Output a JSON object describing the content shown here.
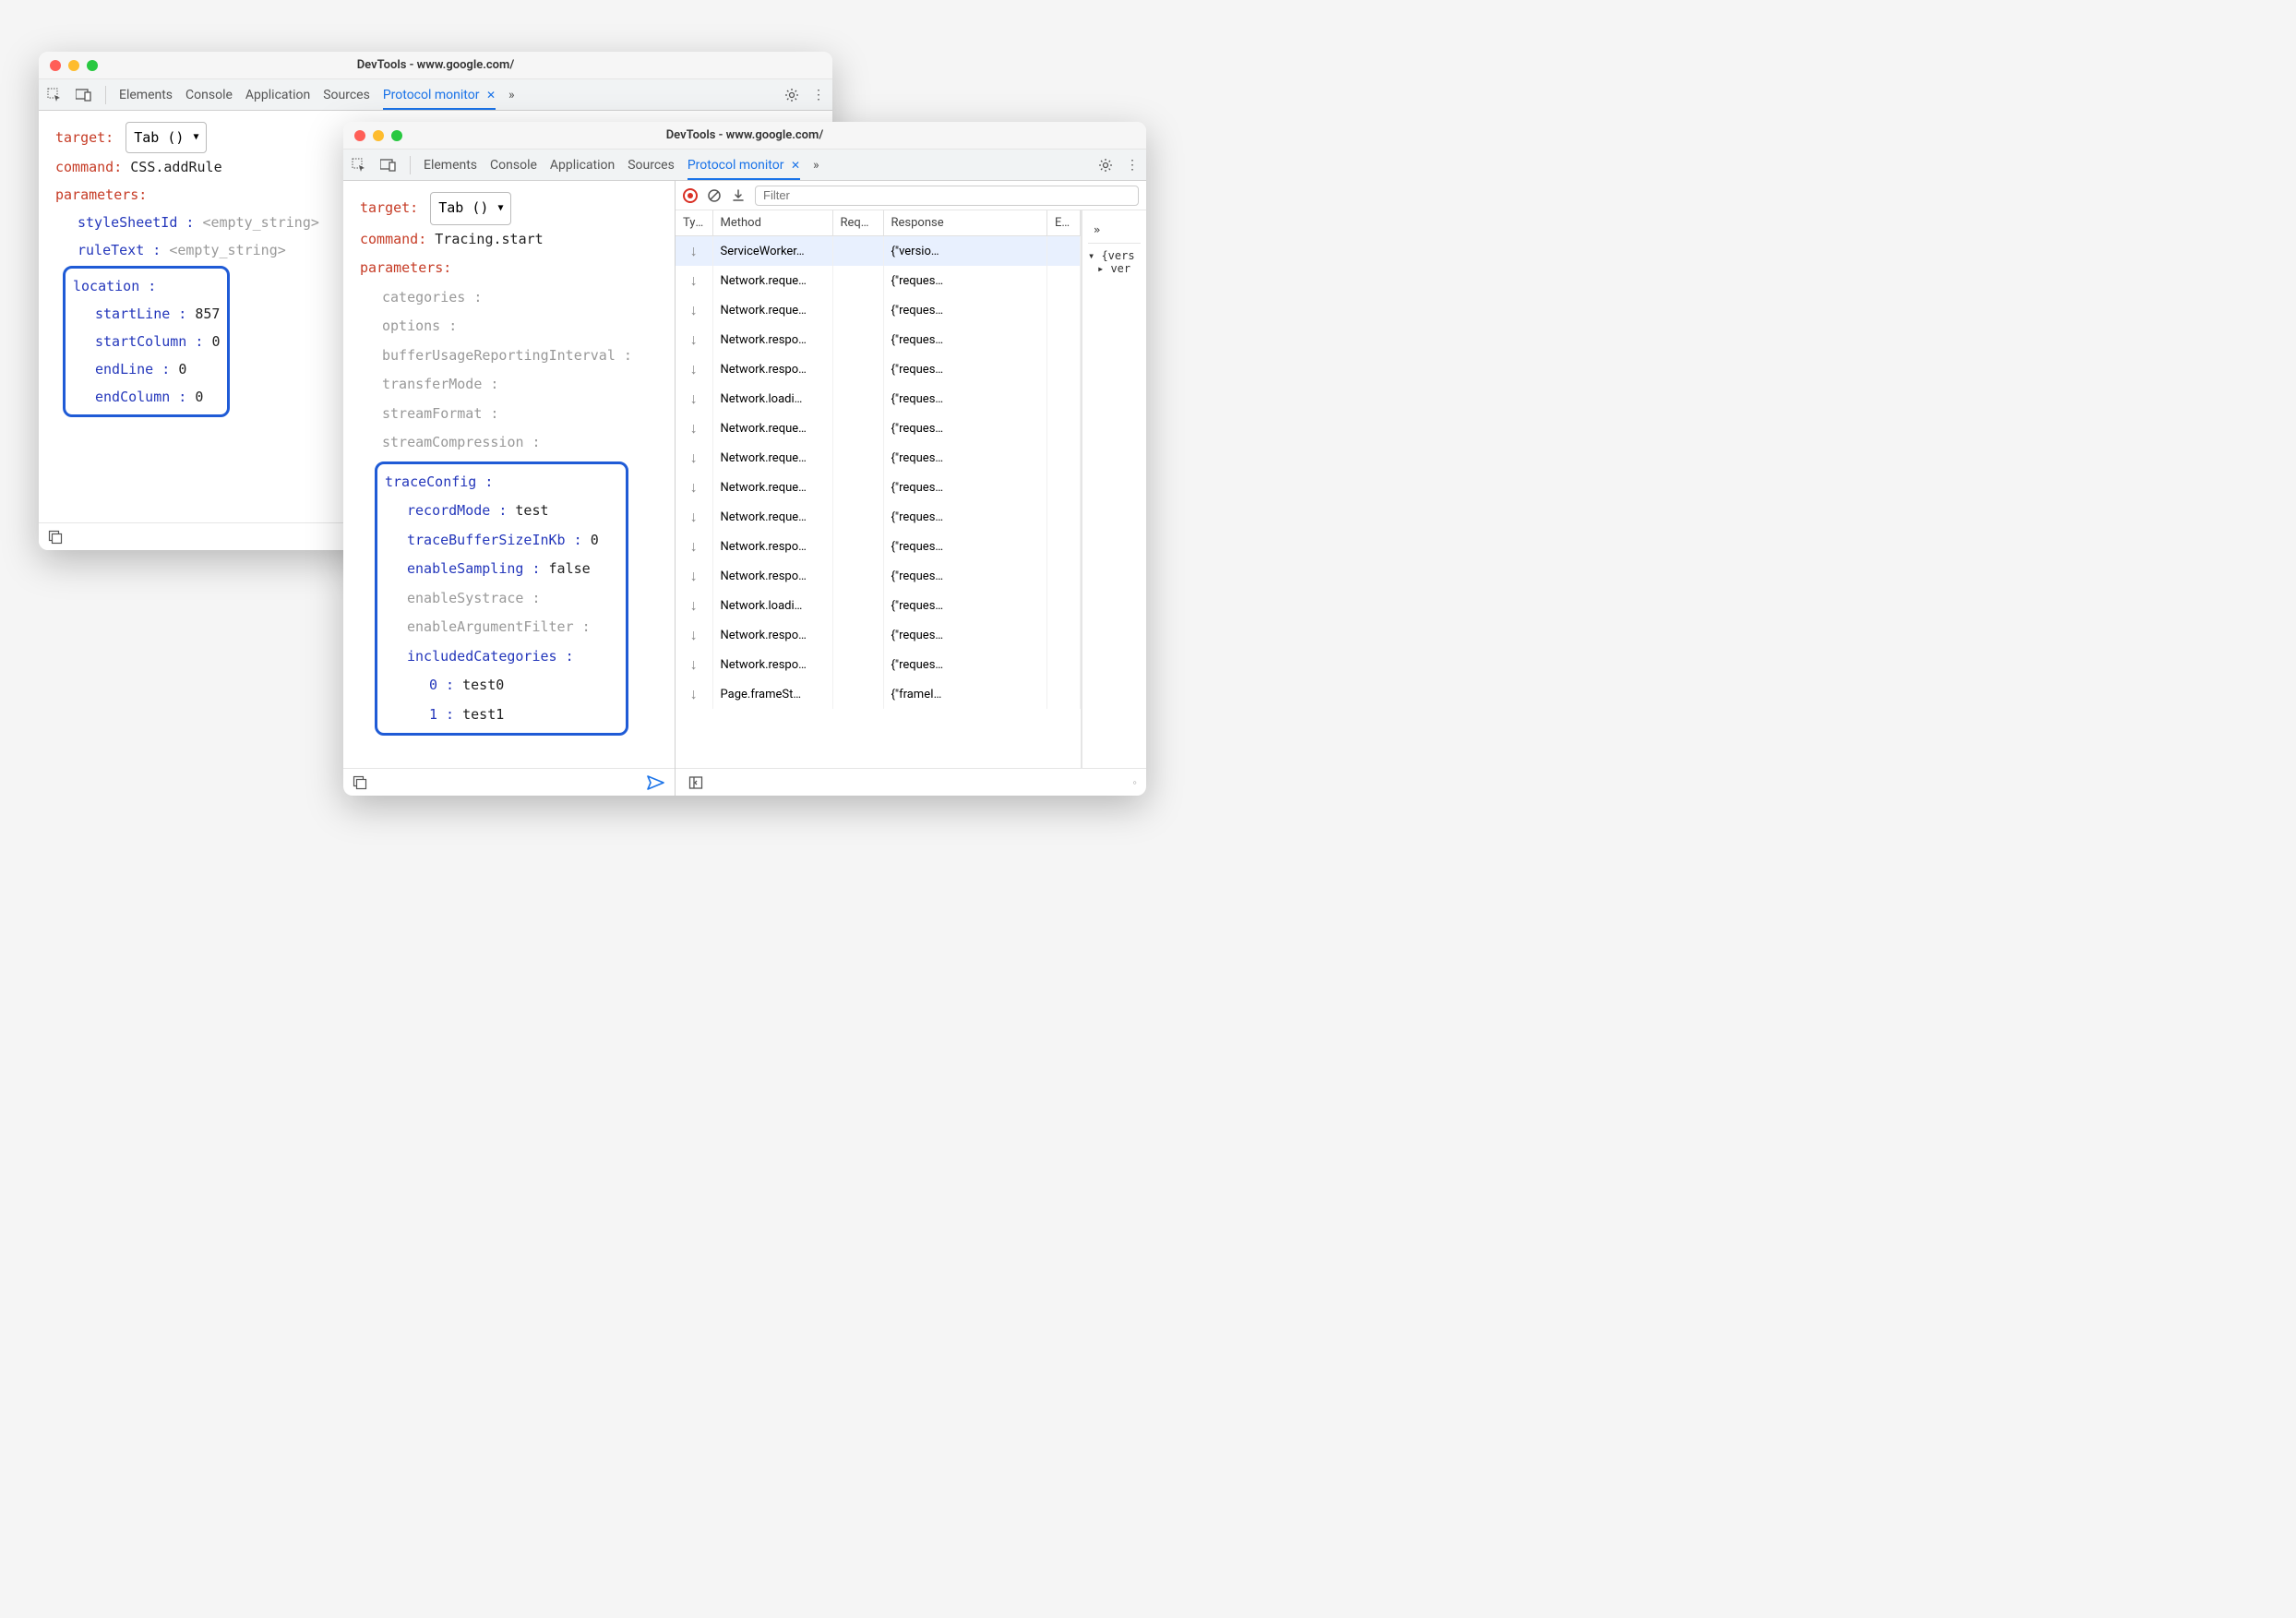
{
  "window_title": "DevTools - www.google.com/",
  "tabs": {
    "elements": "Elements",
    "console": "Console",
    "application": "Application",
    "sources": "Sources",
    "protocol": "Protocol monitor"
  },
  "panel1": {
    "target_label": "target:",
    "target_value": "Tab ()",
    "command_label": "command:",
    "command_value": "CSS.addRule",
    "parameters_label": "parameters:",
    "stylesheet_label": "styleSheetId :",
    "stylesheet_value": "<empty_string>",
    "ruletext_label": "ruleText :",
    "ruletext_value": "<empty_string>",
    "location_label": "location :",
    "startline_label": "startLine :",
    "startline_value": "857",
    "startcol_label": "startColumn :",
    "startcol_value": "0",
    "endline_label": "endLine :",
    "endline_value": "0",
    "endcol_label": "endColumn :",
    "endcol_value": "0"
  },
  "panel2": {
    "target_label": "target:",
    "target_value": "Tab ()",
    "command_label": "command:",
    "command_value": "Tracing.start",
    "parameters_label": "parameters:",
    "categories": "categories :",
    "options": "options :",
    "bufferusage": "bufferUsageReportingInterval :",
    "transfermode": "transferMode :",
    "streamformat": "streamFormat :",
    "streamcomp": "streamCompression :",
    "traceconfig_label": "traceConfig :",
    "recordmode_label": "recordMode :",
    "recordmode_value": "test",
    "tracebuffer_label": "traceBufferSizeInKb :",
    "tracebuffer_value": "0",
    "enablesampling_label": "enableSampling :",
    "enablesampling_value": "false",
    "enablesystrace": "enableSystrace :",
    "enableargfilter": "enableArgumentFilter :",
    "includedcats_label": "includedCategories :",
    "cat0_label": "0 :",
    "cat0_value": "test0",
    "cat1_label": "1 :",
    "cat1_value": "test1"
  },
  "table": {
    "filter_placeholder": "Filter",
    "headers": {
      "type": "Type",
      "method": "Method",
      "request": "Requ…",
      "response": "Response",
      "elapsed": "El.⇡"
    },
    "rows": [
      {
        "method": "ServiceWorker…",
        "response": "{\"versio…"
      },
      {
        "method": "Network.reque…",
        "response": "{\"reques…"
      },
      {
        "method": "Network.reque…",
        "response": "{\"reques…"
      },
      {
        "method": "Network.respo…",
        "response": "{\"reques…"
      },
      {
        "method": "Network.respo…",
        "response": "{\"reques…"
      },
      {
        "method": "Network.loadi…",
        "response": "{\"reques…"
      },
      {
        "method": "Network.reque…",
        "response": "{\"reques…"
      },
      {
        "method": "Network.reque…",
        "response": "{\"reques…"
      },
      {
        "method": "Network.reque…",
        "response": "{\"reques…"
      },
      {
        "method": "Network.reque…",
        "response": "{\"reques…"
      },
      {
        "method": "Network.respo…",
        "response": "{\"reques…"
      },
      {
        "method": "Network.respo…",
        "response": "{\"reques…"
      },
      {
        "method": "Network.loadi…",
        "response": "{\"reques…"
      },
      {
        "method": "Network.respo…",
        "response": "{\"reques…"
      },
      {
        "method": "Network.respo…",
        "response": "{\"reques…"
      },
      {
        "method": "Page.frameSt…",
        "response": "{\"frameI…"
      }
    ],
    "side": {
      "item1": "{vers",
      "item2": "ver"
    }
  }
}
